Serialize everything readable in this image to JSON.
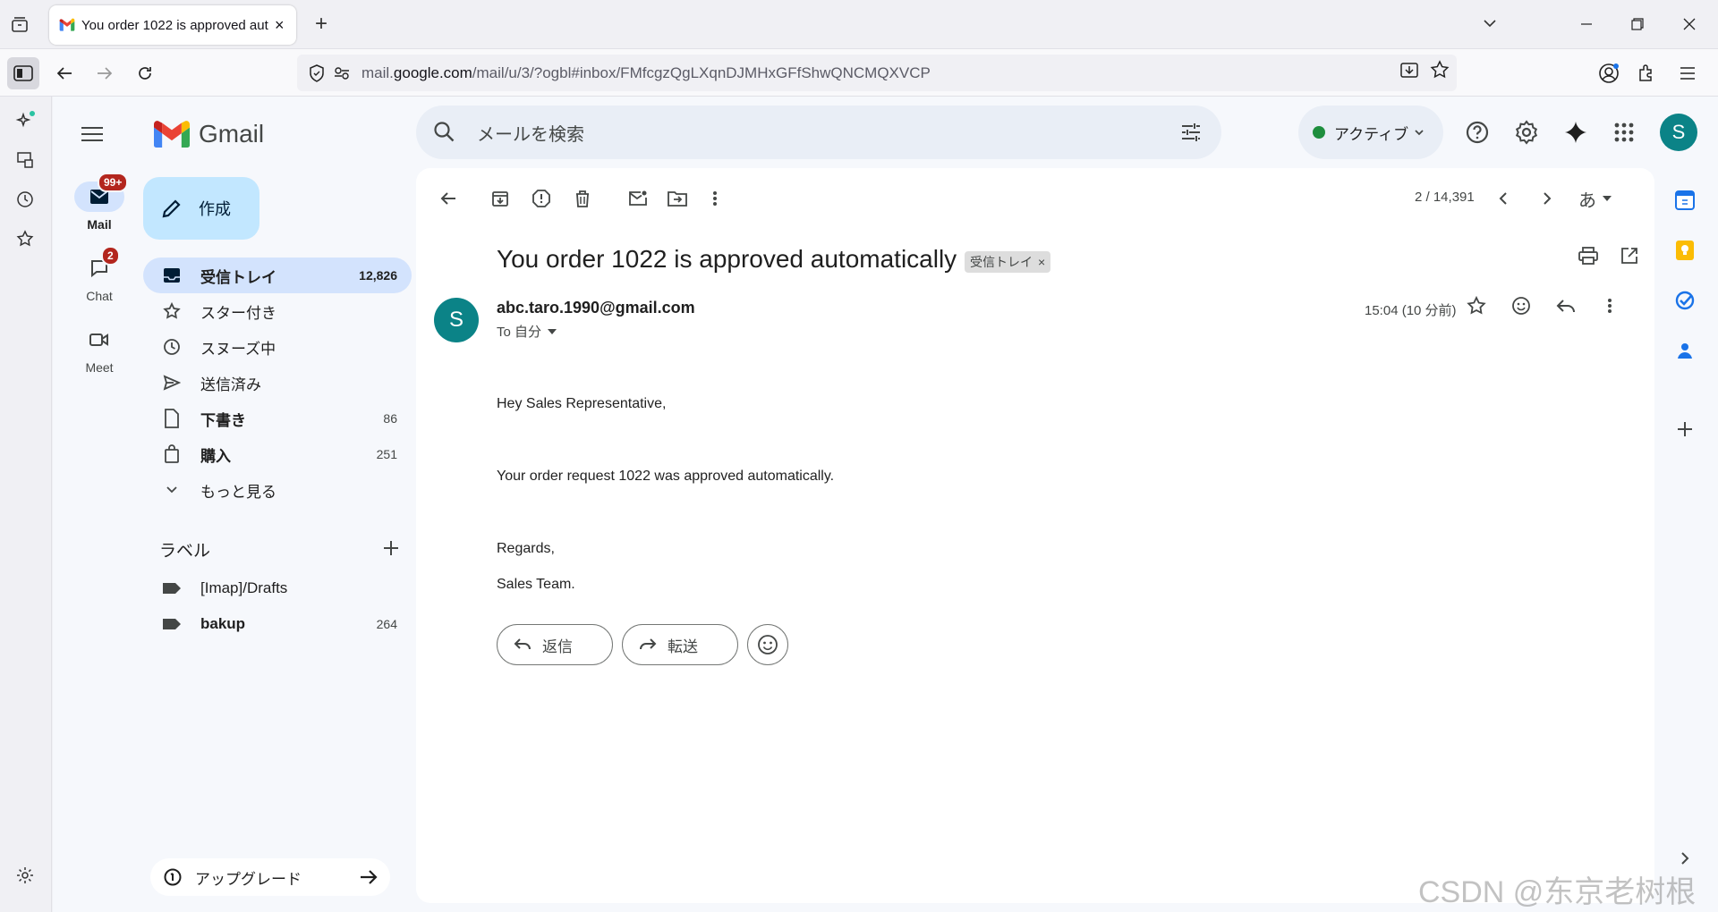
{
  "browser": {
    "tab_title": "You order 1022 is approved automatically",
    "url_host_prefix": "mail.",
    "url_host": "google.com",
    "url_path": "/mail/u/3/?ogbl#inbox/FMfcgzQgLXqnDJMHxGFfShwQNCMQXVCP"
  },
  "gmail": {
    "logo_text": "Gmail",
    "search_placeholder": "メールを検索",
    "status_label": "アクティブ",
    "account_initial": "S",
    "compose_label": "作成",
    "rail": [
      {
        "label": "Mail",
        "badge": "99+"
      },
      {
        "label": "Chat",
        "badge": "2"
      },
      {
        "label": "Meet"
      }
    ],
    "folders": [
      {
        "label": "受信トレイ",
        "count": "12,826"
      },
      {
        "label": "スター付き",
        "count": ""
      },
      {
        "label": "スヌーズ中",
        "count": ""
      },
      {
        "label": "送信済み",
        "count": ""
      },
      {
        "label": "下書き",
        "count": "86"
      },
      {
        "label": "購入",
        "count": "251"
      },
      {
        "label": "もっと見る",
        "count": ""
      }
    ],
    "labels_header": "ラベル",
    "labels": [
      {
        "label": "[Imap]/Drafts",
        "count": ""
      },
      {
        "label": "bakup",
        "count": "264"
      }
    ],
    "upgrade_label": "アップグレード"
  },
  "message": {
    "pager": "2 / 14,391",
    "input_tool": "あ",
    "subject": "You order 1022 is approved automatically",
    "chip_label": "受信トレイ",
    "chip_close": "×",
    "sender_initial": "S",
    "sender": "abc.taro.1990@gmail.com",
    "to_line": "To 自分",
    "time": "15:04 (10 分前)",
    "body": [
      "Hey Sales Representative,",
      "Your order request 1022 was approved automatically.",
      "Regards,",
      "Sales Team."
    ],
    "reply_label": "返信",
    "forward_label": "転送"
  },
  "watermark": "CSDN @东京老树根",
  "colors": {
    "accent": "#0b57d0",
    "compose_bg": "#c2e7ff",
    "active_folder_bg": "#d3e3fd",
    "avatar_bg": "#0b8387",
    "badge": "#b3261e",
    "status_dot": "#1e8e3e"
  }
}
